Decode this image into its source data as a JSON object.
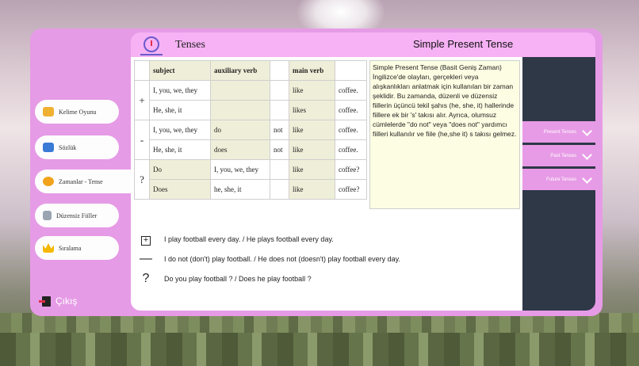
{
  "sidebar": {
    "items": [
      {
        "label": "Kelime Oyunu",
        "icon": "game-controller-icon",
        "color": "#f0b030"
      },
      {
        "label": "Sözlük",
        "icon": "book-icon",
        "color": "#3a7bd5"
      },
      {
        "label": "Zamanlar - Tense",
        "icon": "clock-icon",
        "color": "#f2a31b"
      },
      {
        "label": "Düzensiz Fiiller",
        "icon": "list-icon",
        "color": "#9aa5b1"
      },
      {
        "label": "Sıralama",
        "icon": "crown-icon",
        "color": "#f5b800"
      }
    ],
    "exit_label": "Çıkış"
  },
  "header": {
    "title": "Tenses",
    "subtitle": "Simple Present Tense"
  },
  "table": {
    "headers": [
      "",
      "subject",
      "auxiliary verb",
      "",
      "main verb",
      ""
    ],
    "rows": [
      [
        "+",
        "I, you, we, they",
        "",
        "",
        "like",
        "coffee."
      ],
      [
        "",
        "He, she, it",
        "",
        "",
        "likes",
        "coffee."
      ],
      [
        "-",
        "I, you, we, they",
        "do",
        "not",
        "like",
        "coffee."
      ],
      [
        "",
        "He, she, it",
        "does",
        "not",
        "like",
        "coffee."
      ],
      [
        "?",
        "Do",
        "I, you, we, they",
        "",
        "like",
        "coffee?"
      ],
      [
        "",
        "Does",
        "he, she, it",
        "",
        "like",
        "coffee?"
      ]
    ]
  },
  "description": "Simple Present Tense (Basit Geniş Zaman) İngilizce'de olayları, gerçekleri veya alışkanlıkları anlatmak için kullanılan bir zaman şeklidir. Bu zamanda, düzenli ve düzensiz fiillerin üçüncü tekil şahıs (he, she, it) hallerinde fiillere ek bir 's' takısı alır. Ayrıca, olumsuz cümlelerde \"do not\" veya \"does not\" yardımcı fiilleri kullanılır ve fiile (he,she it) s takısı gelmez.",
  "examples": [
    {
      "symbol": "+",
      "text": "I play football every day. / He plays football every day."
    },
    {
      "symbol": "—",
      "text": "I do not (don't) play football. / He does not (doesn't) play football every day."
    },
    {
      "symbol": "?",
      "text": "Do you play football ? / Does he play football ?"
    }
  ],
  "tense_menu": [
    {
      "label": "Present Tenses"
    },
    {
      "label": "Past Tenses"
    },
    {
      "label": "Future Tenses"
    }
  ]
}
